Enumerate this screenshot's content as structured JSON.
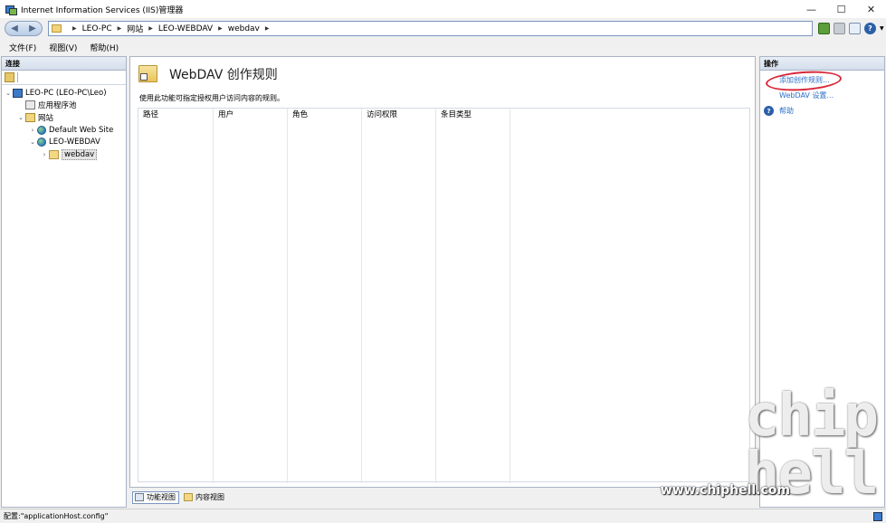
{
  "window": {
    "title": "Internet Information Services (IIS)管理器",
    "controls": [
      "—",
      "☐",
      "✕"
    ]
  },
  "address": {
    "crumbs": [
      "LEO-PC",
      "网站",
      "LEO-WEBDAV",
      "webdav"
    ]
  },
  "menu": [
    "文件(F)",
    "视图(V)",
    "帮助(H)"
  ],
  "connections": {
    "header": "连接",
    "tree": [
      {
        "label": "LEO-PC (LEO-PC\\Leo)",
        "exp": "⌄",
        "icon": "server-icon"
      },
      {
        "label": "应用程序池",
        "exp": "",
        "icon": "app-pool-icon"
      },
      {
        "label": "网站",
        "exp": "⌄",
        "icon": "sites-folder-icon"
      },
      {
        "label": "Default Web Site",
        "exp": "›",
        "icon": "globe-icon"
      },
      {
        "label": "LEO-WEBDAV",
        "exp": "⌄",
        "icon": "globe-icon"
      },
      {
        "label": "webdav",
        "exp": "›",
        "icon": "folder-icon"
      }
    ]
  },
  "feature": {
    "title": "WebDAV 创作规则",
    "description": "使用此功能可指定授权用户访问内容的规则。",
    "columns": [
      "路径",
      "用户",
      "角色",
      "访问权限",
      "条目类型"
    ]
  },
  "view_tabs": [
    "功能视图",
    "内容视图"
  ],
  "actions": {
    "header": "操作",
    "items": [
      "添加创作规则...",
      "WebDAV 设置..."
    ],
    "help": "帮助"
  },
  "watermark": {
    "logo": "chip hell",
    "url": "www.chiphell.com"
  },
  "status": "配置:\"applicationHost.config\""
}
